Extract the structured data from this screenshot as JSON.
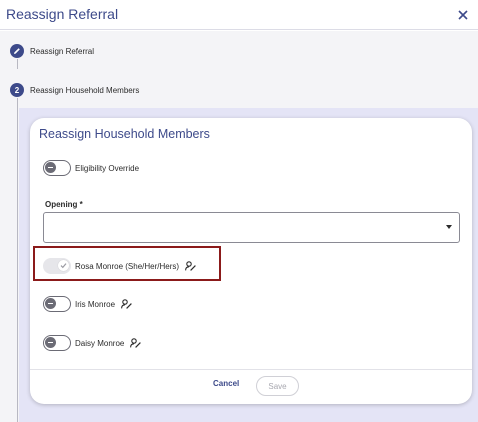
{
  "header": {
    "title": "Reassign Referral"
  },
  "stepper": {
    "steps": [
      {
        "label": "Reassign Referral",
        "indicator": ""
      },
      {
        "label": "Reassign Household Members",
        "indicator": "2"
      }
    ]
  },
  "card": {
    "title": "Reassign Household Members",
    "eligibility_override": {
      "label": "Eligibility Override",
      "checked": false
    },
    "opening": {
      "label": "Opening *",
      "value": ""
    },
    "members": [
      {
        "name": "Rosa Monroe (She/Her/Hers)",
        "checked": true,
        "highlighted": true
      },
      {
        "name": "Iris Monroe",
        "checked": false,
        "highlighted": false
      },
      {
        "name": "Daisy Monroe",
        "checked": false,
        "highlighted": false
      }
    ],
    "footer": {
      "cancel_label": "Cancel",
      "save_label": "Save"
    }
  },
  "colors": {
    "primary": "#3d4a8a",
    "highlight_border": "#8b1a1a",
    "content_bg": "#e4e4f6"
  }
}
